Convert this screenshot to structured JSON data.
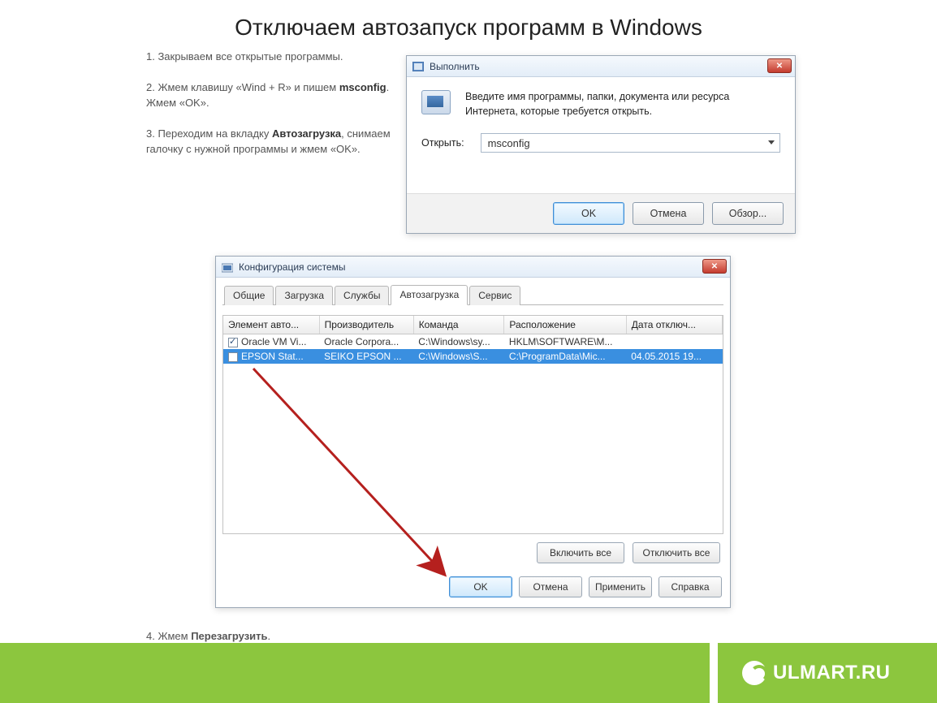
{
  "title": "Отключаем автозапуск программ в Windows",
  "steps": {
    "s1": "1. Закрываем все открытые программы.",
    "s2a": "2. Жмем клавишу «Wind + R» и пишем ",
    "s2b": "msconfig",
    "s2c": ". Жмем «OK».",
    "s3a": "3. Переходим на вкладку ",
    "s3b": "Автозагрузка",
    "s3c": ", снимаем галочку с нужной программы и жмем «OK».",
    "s4a": "4. Жмем ",
    "s4b": "Перезагрузить",
    "s4c": "."
  },
  "run": {
    "title": "Выполнить",
    "msg": "Введите имя программы, папки, документа или ресурса Интернета, которые требуется открыть.",
    "open_label": "Открыть:",
    "value": "msconfig",
    "ok": "OK",
    "cancel": "Отмена",
    "browse": "Обзор..."
  },
  "msc": {
    "title": "Конфигурация системы",
    "tabs": {
      "general": "Общие",
      "boot": "Загрузка",
      "services": "Службы",
      "startup": "Автозагрузка",
      "tools": "Сервис"
    },
    "cols": {
      "item": "Элемент авто...",
      "mfr": "Производитель",
      "cmd": "Команда",
      "loc": "Расположение",
      "date": "Дата отключ..."
    },
    "rows": [
      {
        "checked": true,
        "item": "Oracle VM Vi...",
        "mfr": "Oracle Corpora...",
        "cmd": "C:\\Windows\\sy...",
        "loc": "HKLM\\SOFTWARE\\M...",
        "date": ""
      },
      {
        "checked": false,
        "item": "EPSON Stat...",
        "mfr": "SEIKO EPSON ...",
        "cmd": "C:\\Windows\\S...",
        "loc": "C:\\ProgramData\\Mic...",
        "date": "04.05.2015 19..."
      }
    ],
    "enable_all": "Включить все",
    "disable_all": "Отключить все",
    "ok": "OK",
    "cancel": "Отмена",
    "apply": "Применить",
    "help": "Справка"
  },
  "footer": "ULMART.RU"
}
